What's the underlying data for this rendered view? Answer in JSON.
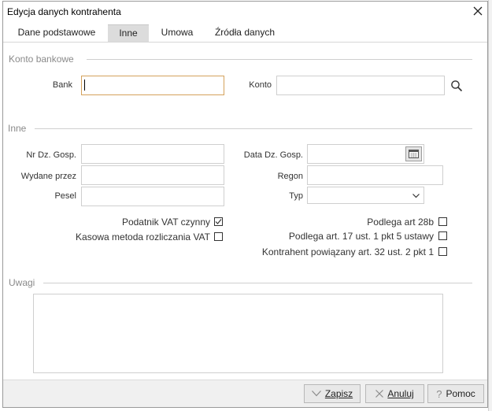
{
  "window": {
    "title": "Edycja danych kontrahenta"
  },
  "tabs": [
    {
      "label": "Dane podstawowe",
      "active": false
    },
    {
      "label": "Inne",
      "active": true
    },
    {
      "label": "Umowa",
      "active": false
    },
    {
      "label": "Źródła danych",
      "active": false
    }
  ],
  "bank_section": {
    "title": "Konto bankowe",
    "bank_label": "Bank",
    "bank_value": "",
    "konto_label": "Konto",
    "konto_value": ""
  },
  "other_section": {
    "title": "Inne",
    "nr_dz_gosp_label": "Nr Dz. Gosp.",
    "data_dz_gosp_label": "Data Dz. Gosp.",
    "wydane_przez_label": "Wydane przez",
    "regon_label": "Regon",
    "pesel_label": "Pesel",
    "typ_label": "Typ"
  },
  "checkboxes": {
    "podatnik_vat": {
      "label": "Podatnik VAT czynny",
      "checked": true
    },
    "kasowa": {
      "label": "Kasowa metoda rozliczania VAT",
      "checked": false
    },
    "art28b": {
      "label": "Podlega art 28b",
      "checked": false
    },
    "art17": {
      "label": "Podlega art. 17 ust. 1 pkt 5 ustawy",
      "checked": false
    },
    "art32": {
      "label": "Kontrahent powiązany art. 32 ust. 2 pkt 1",
      "checked": false
    }
  },
  "notes_section": {
    "title": "Uwagi",
    "value": ""
  },
  "footer": {
    "save_label": "Zapisz",
    "cancel_label": "Anuluj",
    "help_label": "Pomoc"
  },
  "icons": {
    "search": "search-icon",
    "calendar": "calendar-icon",
    "chevron": "chevron-down-icon",
    "close": "close-icon"
  }
}
